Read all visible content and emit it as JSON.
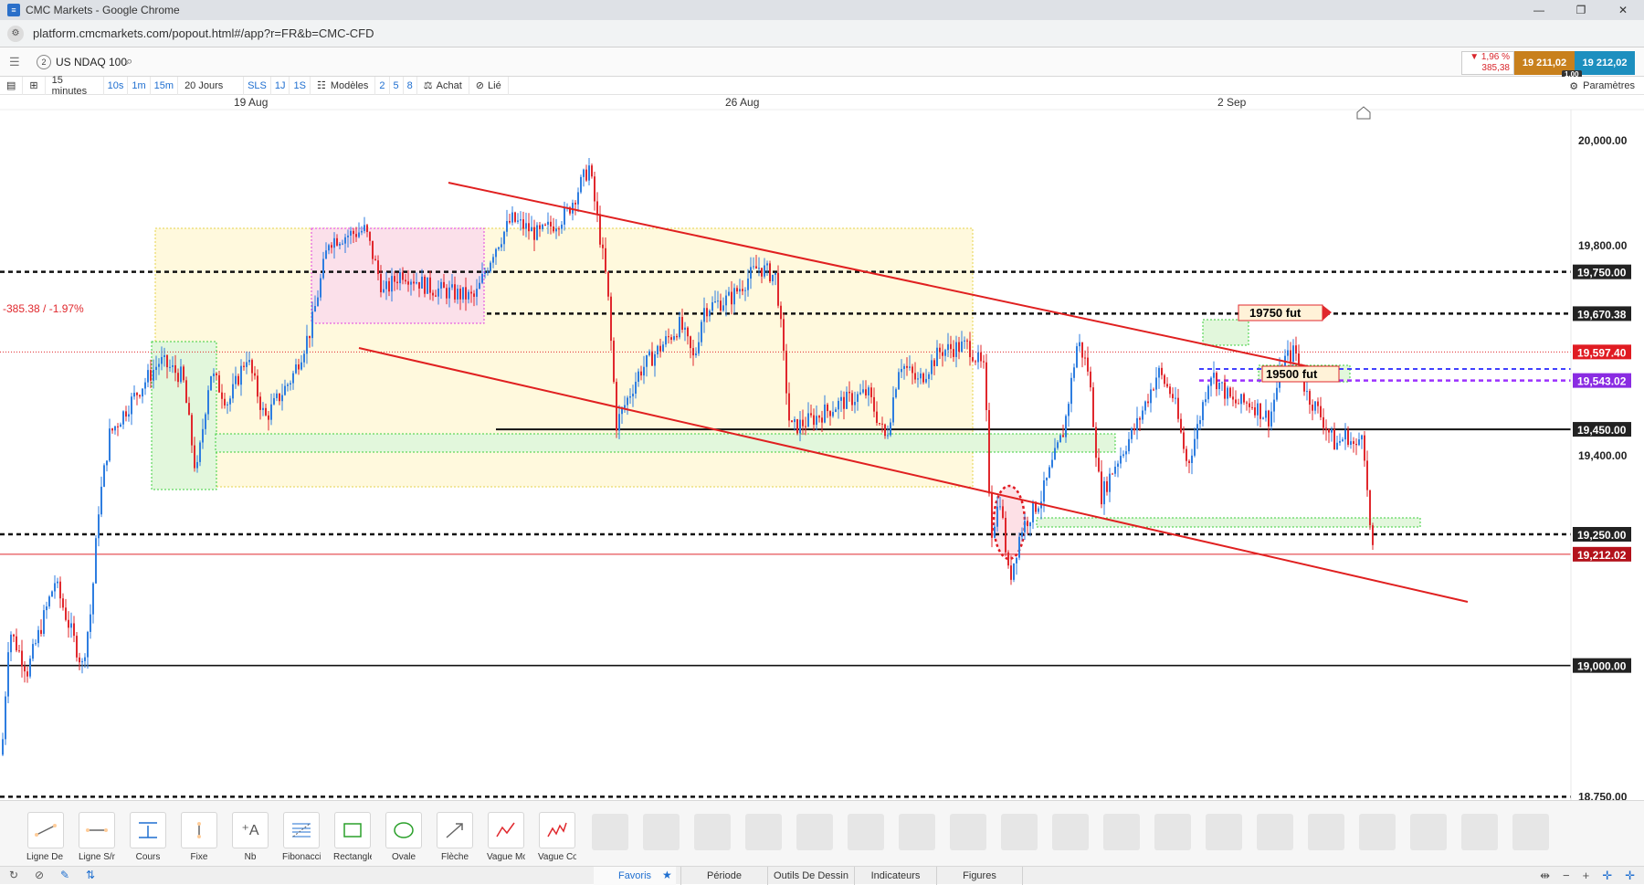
{
  "window": {
    "title": "CMC Markets - Google Chrome",
    "controls": [
      "—",
      "❐",
      "✕"
    ],
    "url": "platform.cmcmarkets.com/popout.html#/app?r=FR&b=CMC-CFD"
  },
  "header": {
    "instrument_code": "2",
    "instrument_name": "US NDAQ 100",
    "change_pct": "▼ 1,96 %",
    "change_abs": "385,38",
    "sell_price": "19 211,02",
    "buy_price": "19 212,02",
    "spread": "1,00"
  },
  "toolbar": {
    "interval": "15 minutes",
    "intervals_quick": [
      "10s",
      "1m",
      "15m"
    ],
    "range": "20 Jours",
    "range_quick": [
      "SLS",
      "1J",
      "1S"
    ],
    "models": "Modèles",
    "model_quick": [
      "2",
      "5",
      "8"
    ],
    "buy": "Achat",
    "linked": "Lié",
    "settings": "Paramètres"
  },
  "chart_data": {
    "type": "candlestick",
    "instrument": "US NDAQ 100",
    "interval": "15 minutes",
    "x_labels": [
      "19 Aug",
      "26 Aug",
      "2 Sep"
    ],
    "ylim": [
      18730,
      20100
    ],
    "y_ticks": [
      "20,000.00",
      "19,800.00",
      "19,400.00",
      "18,750.00"
    ],
    "price_labels": [
      {
        "value": "19,750.00",
        "bg": "#222222"
      },
      {
        "value": "19,670.38",
        "bg": "#222222"
      },
      {
        "value": "19,597.40",
        "bg": "#e01b22"
      },
      {
        "value": "19,543.02",
        "bg": "#8a2be2"
      },
      {
        "value": "19,450.00",
        "bg": "#222222"
      },
      {
        "value": "19,250.00",
        "bg": "#222222"
      },
      {
        "value": "19,212.02",
        "bg": "#b3121b"
      },
      {
        "value": "19,000.00",
        "bg": "#222222"
      }
    ],
    "annotations": {
      "change_text": "-385.38 / -1.97%",
      "label_19750": "19750  fut",
      "label_19500": "19500  fut"
    },
    "colors": {
      "up": "#2e7de0",
      "down": "#e0282d",
      "trend": "#e02020"
    }
  },
  "draw_tools": [
    {
      "name": "line-tool",
      "label": "Ligne De ..."
    },
    {
      "name": "hline-tool",
      "label": "Ligne S/r"
    },
    {
      "name": "price-tool",
      "label": "Cours"
    },
    {
      "name": "fixed-tool",
      "label": "Fixe"
    },
    {
      "name": "text-tool",
      "label": "Nb"
    },
    {
      "name": "fibonacci-tool",
      "label": "Fibonacci"
    },
    {
      "name": "rectangle-tool",
      "label": "Rectangle"
    },
    {
      "name": "oval-tool",
      "label": "Ovale"
    },
    {
      "name": "arrow-tool",
      "label": "Flèche"
    },
    {
      "name": "wave-tool",
      "label": "Vague Mo..."
    },
    {
      "name": "wave2-tool",
      "label": "Vague Co..."
    }
  ],
  "bottom_tabs": [
    "Favoris",
    "Période",
    "Outils De Dessin",
    "Indicateurs",
    "Figures"
  ]
}
